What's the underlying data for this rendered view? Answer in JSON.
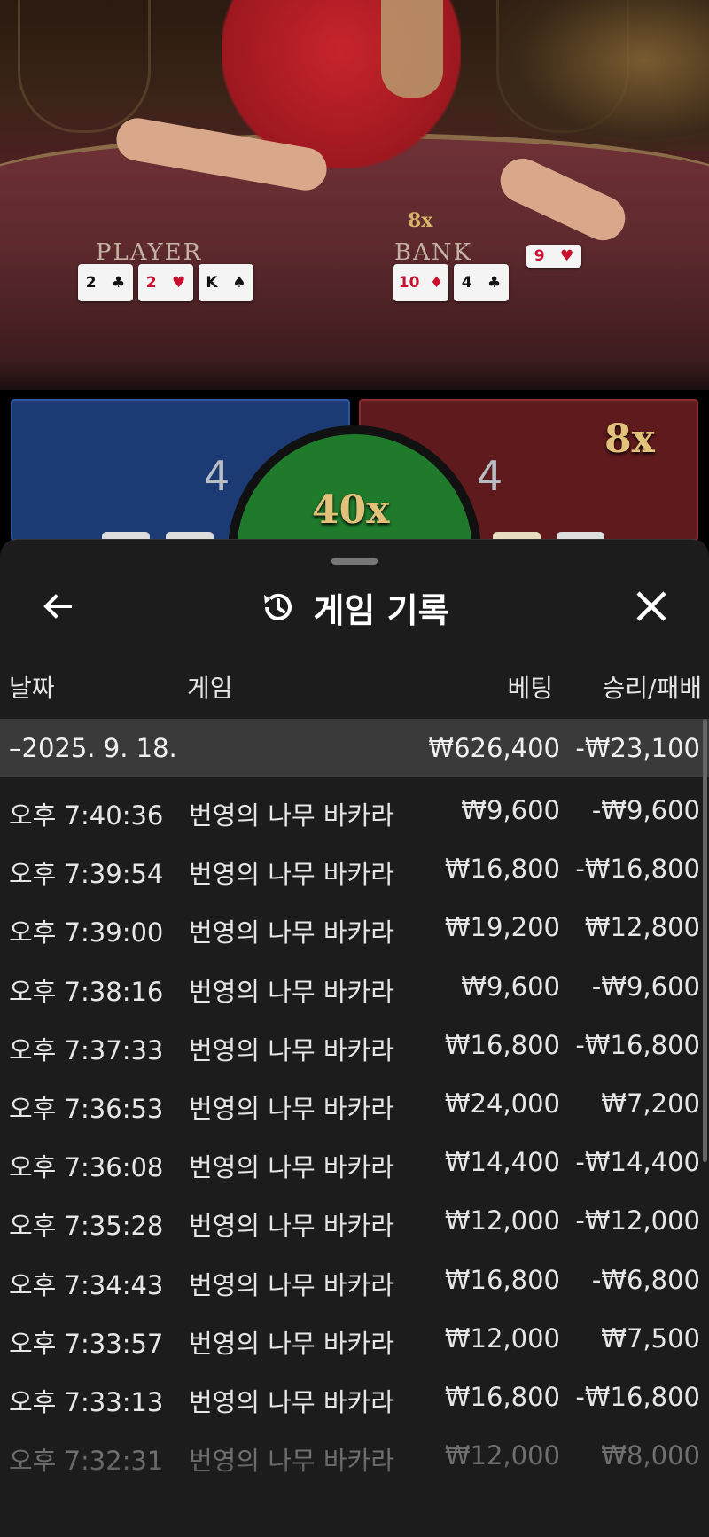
{
  "video": {
    "player_label": "PLAYER",
    "banker_label": "BANK",
    "banker_side_multiplier": "8x",
    "player_cards": [
      {
        "rank": "2",
        "suit": "♣",
        "color": "black"
      },
      {
        "rank": "2",
        "suit": "♥",
        "color": "red"
      },
      {
        "rank": "K",
        "suit": "♠",
        "color": "black"
      }
    ],
    "banker_cards": [
      {
        "rank": "10",
        "suit": "♦",
        "color": "red"
      },
      {
        "rank": "4",
        "suit": "♣",
        "color": "black"
      },
      {
        "rank": "9",
        "suit": "♥",
        "color": "red"
      }
    ],
    "player_score": "4",
    "banker_score": "4",
    "tie_multiplier": "40x",
    "banker_multiplier": "8x"
  },
  "sheet": {
    "title": "게임 기록",
    "icons": {
      "back": "arrow-left-icon",
      "history": "history-icon",
      "close": "close-icon"
    },
    "columns": {
      "date": "날짜",
      "game": "게임",
      "bet": "베팅",
      "win_loss": "승리/패배"
    },
    "summary": {
      "date": "–2025. 9. 18.",
      "bet": "₩626,400",
      "win_loss": "-₩23,100"
    },
    "rows": [
      {
        "time": "오후 7:40:36",
        "game": "번영의 나무 바카라",
        "bet": "₩9,600",
        "win_loss": "-₩9,600"
      },
      {
        "time": "오후 7:39:54",
        "game": "번영의 나무 바카라",
        "bet": "₩16,800",
        "win_loss": "-₩16,800"
      },
      {
        "time": "오후 7:39:00",
        "game": "번영의 나무 바카라",
        "bet": "₩19,200",
        "win_loss": "₩12,800"
      },
      {
        "time": "오후 7:38:16",
        "game": "번영의 나무 바카라",
        "bet": "₩9,600",
        "win_loss": "-₩9,600"
      },
      {
        "time": "오후 7:37:33",
        "game": "번영의 나무 바카라",
        "bet": "₩16,800",
        "win_loss": "-₩16,800"
      },
      {
        "time": "오후 7:36:53",
        "game": "번영의 나무 바카라",
        "bet": "₩24,000",
        "win_loss": "₩7,200"
      },
      {
        "time": "오후 7:36:08",
        "game": "번영의 나무 바카라",
        "bet": "₩14,400",
        "win_loss": "-₩14,400"
      },
      {
        "time": "오후 7:35:28",
        "game": "번영의 나무 바카라",
        "bet": "₩12,000",
        "win_loss": "-₩12,000"
      },
      {
        "time": "오후 7:34:43",
        "game": "번영의 나무 바카라",
        "bet": "₩16,800",
        "win_loss": "-₩6,800"
      },
      {
        "time": "오후 7:33:57",
        "game": "번영의 나무 바카라",
        "bet": "₩12,000",
        "win_loss": "₩7,500"
      },
      {
        "time": "오후 7:33:13",
        "game": "번영의 나무 바카라",
        "bet": "₩16,800",
        "win_loss": "-₩16,800"
      },
      {
        "time": "오후 7:32:31",
        "game": "번영의 나무 바카라",
        "bet": "₩12,000",
        "win_loss": "₩8,000"
      }
    ]
  }
}
